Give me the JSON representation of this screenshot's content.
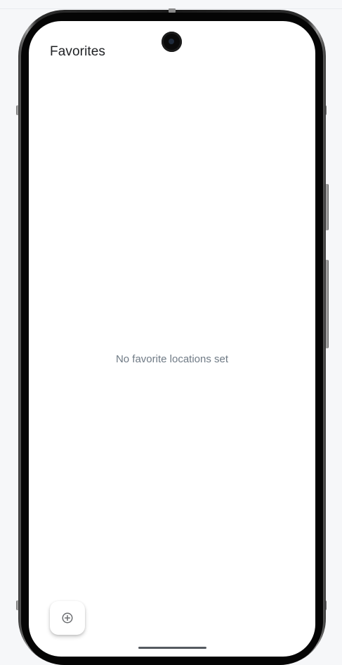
{
  "header": {
    "title": "Favorites"
  },
  "main": {
    "empty_message": "No favorite locations set"
  },
  "fab": {
    "icon": "add-circle-icon"
  },
  "colors": {
    "background": "#f6f7f9",
    "screen": "#ffffff",
    "title_text": "#1f2124",
    "empty_text": "#6f7a85",
    "fab_icon": "#6d6f72"
  }
}
